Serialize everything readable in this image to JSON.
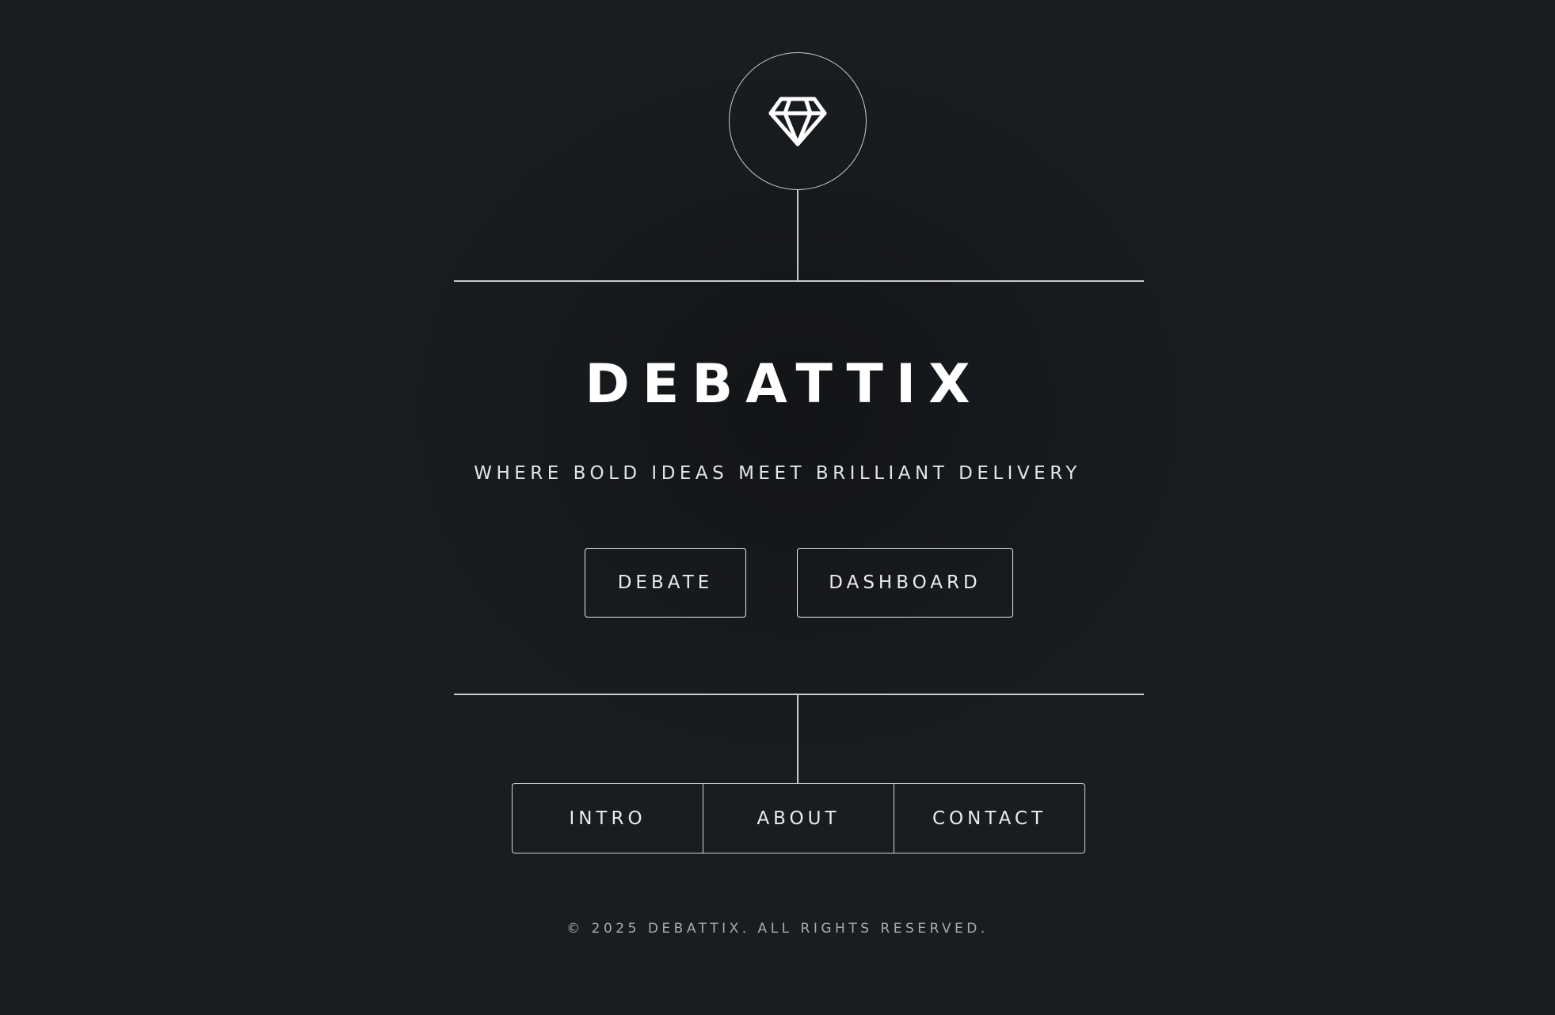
{
  "brand": {
    "logo_icon": "diamond-icon",
    "title": "DEBATTIX",
    "tagline": "WHERE BOLD IDEAS MEET BRILLIANT DELIVERY"
  },
  "actions": {
    "debate_label": "DEBATE",
    "dashboard_label": "DASHBOARD"
  },
  "nav": {
    "items": [
      {
        "label": "INTRO"
      },
      {
        "label": "ABOUT"
      },
      {
        "label": "CONTACT"
      }
    ]
  },
  "footer": {
    "copyright": "© 2025 DEBATTIX. ALL RIGHTS RESERVED."
  },
  "colors": {
    "background": "#181b1f",
    "foreground": "#ffffff",
    "line": "#c9cacc"
  }
}
